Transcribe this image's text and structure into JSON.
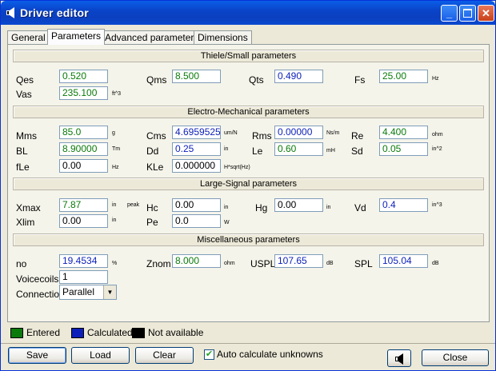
{
  "window": {
    "title": "Driver editor"
  },
  "tabs": [
    "General",
    "Parameters",
    "Advanced parameters",
    "Dimensions"
  ],
  "sections": {
    "thiele": "Thiele/Small parameters",
    "electro": "Electro-Mechanical parameters",
    "large": "Large-Signal parameters",
    "misc": "Miscellaneous parameters"
  },
  "params": {
    "qes": {
      "label": "Qes",
      "value": "0.520",
      "unit": ""
    },
    "qms": {
      "label": "Qms",
      "value": "8.500",
      "unit": ""
    },
    "qts": {
      "label": "Qts",
      "value": "0.490",
      "unit": ""
    },
    "fs": {
      "label": "Fs",
      "value": "25.00",
      "unit": "Hz"
    },
    "vas": {
      "label": "Vas",
      "value": "235.100",
      "unit": "ft^3"
    },
    "mms": {
      "label": "Mms",
      "value": "85.0",
      "unit": "g"
    },
    "cms": {
      "label": "Cms",
      "value": "4.6959525",
      "unit": "um/N"
    },
    "rms": {
      "label": "Rms",
      "value": "0.00000",
      "unit": "Ns/m"
    },
    "re": {
      "label": "Re",
      "value": "4.400",
      "unit": "ohm"
    },
    "bl": {
      "label": "BL",
      "value": "8.90000",
      "unit": "Tm"
    },
    "dd": {
      "label": "Dd",
      "value": "0.25",
      "unit": "in"
    },
    "le": {
      "label": "Le",
      "value": "0.60",
      "unit": "mH"
    },
    "sd": {
      "label": "Sd",
      "value": "0.05",
      "unit": "in^2"
    },
    "fle": {
      "label": "fLe",
      "value": "0.00",
      "unit": "Hz"
    },
    "kle": {
      "label": "KLe",
      "value": "0.000000",
      "unit": "H*sqrt(Hz)"
    },
    "xmax": {
      "label": "Xmax",
      "value": "7.87",
      "unit": "in",
      "extra": "peak"
    },
    "hc": {
      "label": "Hc",
      "value": "0.00",
      "unit": "in"
    },
    "hg": {
      "label": "Hg",
      "value": "0.00",
      "unit": "in"
    },
    "vd": {
      "label": "Vd",
      "value": "0.4",
      "unit": "in^3"
    },
    "xlim": {
      "label": "Xlim",
      "value": "0.00",
      "unit": "in"
    },
    "pe": {
      "label": "Pe",
      "value": "0.0",
      "unit": "W"
    },
    "no": {
      "label": "no",
      "value": "19.4534",
      "unit": "%"
    },
    "znom": {
      "label": "Znom",
      "value": "8.000",
      "unit": "ohm"
    },
    "uspl": {
      "label": "USPL",
      "value": "107.65",
      "unit": "dB"
    },
    "spl": {
      "label": "SPL",
      "value": "105.04",
      "unit": "dB"
    },
    "voicecoils": {
      "label": "Voicecoils",
      "value": "1"
    },
    "connection": {
      "label": "Connection",
      "value": "Parallel"
    }
  },
  "legend": {
    "entered": {
      "label": "Entered",
      "color": "#0a7a0a"
    },
    "calculated": {
      "label": "Calculated",
      "color": "#0c1fb8"
    },
    "na": {
      "label": "Not available",
      "color": "#000000"
    }
  },
  "buttons": {
    "save": "Save",
    "load": "Load",
    "clear": "Clear",
    "auto": "Auto calculate unknowns",
    "close": "Close"
  }
}
